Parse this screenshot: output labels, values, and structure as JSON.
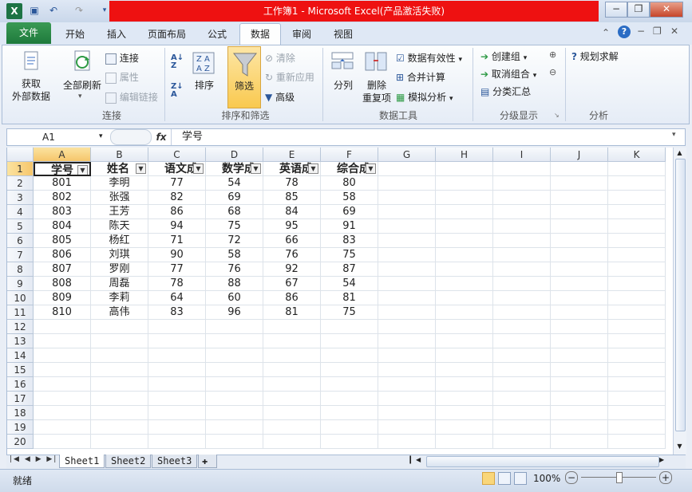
{
  "window": {
    "title": "工作簿1 - Microsoft Excel(产品激活失败)",
    "minimize": "−",
    "restore": "❐",
    "close": "✕"
  },
  "tabs": [
    "文件",
    "开始",
    "插入",
    "页面布局",
    "公式",
    "数据",
    "审阅",
    "视图"
  ],
  "ribbon": {
    "get_external": [
      "获取",
      "外部数据"
    ],
    "refresh_all": "全部刷新",
    "connections": "连接",
    "properties": "属性",
    "edit_links": "编辑链接",
    "group_connections": "连接",
    "sort": "排序",
    "filter": "筛选",
    "clear": "清除",
    "reapply": "重新应用",
    "advanced": "高级",
    "group_sort_filter": "排序和筛选",
    "split": "分列",
    "remove_dup": [
      "删除",
      "重复项"
    ],
    "data_validation": "数据有效性",
    "consolidate": "合并计算",
    "what_if": "模拟分析",
    "group_data_tools": "数据工具",
    "group_create": "创建组",
    "ungroup": "取消组合",
    "subtotal": "分类汇总",
    "group_outline": "分级显示",
    "solver": "规划求解",
    "group_analysis": "分析"
  },
  "formula_bar": {
    "name_box": "A1",
    "fx": "fx",
    "content": "学号"
  },
  "columns": [
    "A",
    "B",
    "C",
    "D",
    "E",
    "F",
    "G",
    "H",
    "I",
    "J",
    "K"
  ],
  "headers": [
    "学号",
    "姓名",
    "语文成",
    "数学成",
    "英语成",
    "综合成"
  ],
  "rows": [
    [
      "801",
      "李明",
      "77",
      "54",
      "78",
      "80"
    ],
    [
      "802",
      "张强",
      "82",
      "69",
      "85",
      "58"
    ],
    [
      "803",
      "王芳",
      "86",
      "68",
      "84",
      "69"
    ],
    [
      "804",
      "陈天",
      "94",
      "75",
      "95",
      "91"
    ],
    [
      "805",
      "杨红",
      "71",
      "72",
      "66",
      "83"
    ],
    [
      "806",
      "刘琪",
      "90",
      "58",
      "76",
      "75"
    ],
    [
      "807",
      "罗刚",
      "77",
      "76",
      "92",
      "87"
    ],
    [
      "808",
      "周磊",
      "78",
      "88",
      "67",
      "54"
    ],
    [
      "809",
      "李莉",
      "64",
      "60",
      "86",
      "81"
    ],
    [
      "810",
      "高伟",
      "83",
      "96",
      "81",
      "75"
    ]
  ],
  "row_numbers": [
    "1",
    "2",
    "3",
    "4",
    "5",
    "6",
    "7",
    "8",
    "9",
    "10",
    "11",
    "12",
    "13",
    "14",
    "15",
    "16",
    "17",
    "18",
    "19",
    "20"
  ],
  "sheets": [
    "Sheet1",
    "Sheet2",
    "Sheet3"
  ],
  "status": {
    "ready": "就绪",
    "zoom": "100%"
  },
  "colors": {
    "title_highlight": "#ee1111",
    "file_tab": "#1e7a3c",
    "filter_active": "#f9c94f"
  }
}
